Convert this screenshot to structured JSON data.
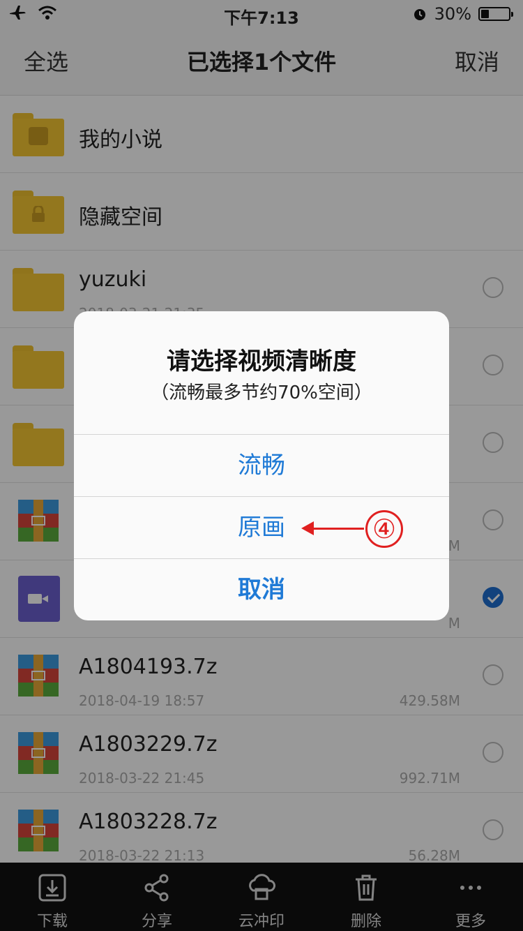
{
  "status": {
    "time": "下午7:13",
    "battery": "30%",
    "battery_level": 0.3
  },
  "nav": {
    "select_all": "全选",
    "title": "已选择1个文件",
    "cancel": "取消"
  },
  "files": [
    {
      "name": "我的小说",
      "kind": "folder",
      "folder_glyph": "book-icon"
    },
    {
      "name": "隐藏空间",
      "kind": "folder",
      "folder_glyph": "lock-icon"
    },
    {
      "name": "yuzuki",
      "date": "2018-03-21 21:35",
      "kind": "folder",
      "checked": false
    },
    {
      "name": "",
      "kind": "folder",
      "checked": false
    },
    {
      "name": "",
      "kind": "folder",
      "checked": false
    },
    {
      "name": "",
      "size": "M",
      "kind": "archive",
      "checked": false
    },
    {
      "name": "",
      "size": "M",
      "kind": "video",
      "checked": true
    },
    {
      "name": "A1804193.7z",
      "date": "2018-04-19 18:57",
      "size": "429.58M",
      "kind": "archive",
      "checked": false
    },
    {
      "name": "A1803229.7z",
      "date": "2018-03-22 21:45",
      "size": "992.71M",
      "kind": "archive",
      "checked": false
    },
    {
      "name": "A1803228.7z",
      "date": "2018-03-22 21:13",
      "size": "56.28M",
      "kind": "archive",
      "checked": false
    }
  ],
  "dialog": {
    "title": "请选择视频清晰度",
    "message": "（流畅最多节约70%空间）",
    "buttons": [
      "流畅",
      "原画",
      "取消"
    ]
  },
  "annotation": {
    "number": "④",
    "color": "#e02020"
  },
  "toolbar": [
    {
      "label": "下载",
      "icon": "download-icon"
    },
    {
      "label": "分享",
      "icon": "share-icon"
    },
    {
      "label": "云冲印",
      "icon": "cloud-print-icon"
    },
    {
      "label": "删除",
      "icon": "trash-icon"
    },
    {
      "label": "更多",
      "icon": "more-icon"
    }
  ],
  "colors": {
    "accent": "#1f7ad6",
    "folder": "#f5c733",
    "check": "#1f6fd1"
  }
}
